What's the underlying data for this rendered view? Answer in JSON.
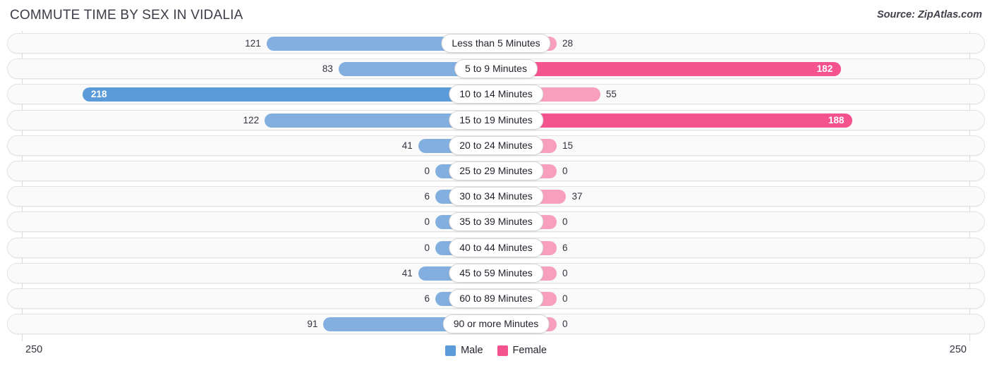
{
  "header": {
    "title": "COMMUTE TIME BY SEX IN VIDALIA",
    "source": "Source: ZipAtlas.com"
  },
  "axis": {
    "left_tick": "250",
    "right_tick": "250",
    "max": 250
  },
  "legend": [
    {
      "label": "Male",
      "color": "#5B9BD9"
    },
    {
      "label": "Female",
      "color": "#F4538E"
    }
  ],
  "colors": {
    "male_light": "#82AFE0",
    "male_dark": "#5B9BD9",
    "female_light": "#F79FBC",
    "female_dark": "#F4538E",
    "track": "#fafafa",
    "track_border": "#e3e3e3"
  },
  "chart_data": {
    "type": "bar",
    "title": "COMMUTE TIME BY SEX IN VIDALIA",
    "subtitle": "Source: ZipAtlas.com",
    "orientation": "horizontal-diverging",
    "xlabel": "",
    "ylabel": "",
    "xlim": [
      250,
      250
    ],
    "grid": false,
    "legend_position": "bottom-center",
    "categories": [
      "Less than 5 Minutes",
      "5 to 9 Minutes",
      "10 to 14 Minutes",
      "15 to 19 Minutes",
      "20 to 24 Minutes",
      "25 to 29 Minutes",
      "30 to 34 Minutes",
      "35 to 39 Minutes",
      "40 to 44 Minutes",
      "45 to 59 Minutes",
      "60 to 89 Minutes",
      "90 or more Minutes"
    ],
    "series": [
      {
        "name": "Male",
        "values": [
          121,
          83,
          218,
          122,
          41,
          0,
          6,
          0,
          0,
          41,
          6,
          91
        ]
      },
      {
        "name": "Female",
        "values": [
          28,
          182,
          55,
          188,
          15,
          0,
          37,
          0,
          6,
          0,
          0,
          0
        ]
      }
    ]
  },
  "rows": [
    {
      "category": "Less than 5 Minutes",
      "male": "121",
      "female": "28"
    },
    {
      "category": "5 to 9 Minutes",
      "male": "83",
      "female": "182"
    },
    {
      "category": "10 to 14 Minutes",
      "male": "218",
      "female": "55"
    },
    {
      "category": "15 to 19 Minutes",
      "male": "122",
      "female": "188"
    },
    {
      "category": "20 to 24 Minutes",
      "male": "41",
      "female": "15"
    },
    {
      "category": "25 to 29 Minutes",
      "male": "0",
      "female": "0"
    },
    {
      "category": "30 to 34 Minutes",
      "male": "6",
      "female": "37"
    },
    {
      "category": "35 to 39 Minutes",
      "male": "0",
      "female": "0"
    },
    {
      "category": "40 to 44 Minutes",
      "male": "0",
      "female": "6"
    },
    {
      "category": "45 to 59 Minutes",
      "male": "41",
      "female": "0"
    },
    {
      "category": "60 to 89 Minutes",
      "male": "6",
      "female": "0"
    },
    {
      "category": "90 or more Minutes",
      "male": "91",
      "female": "0"
    }
  ]
}
